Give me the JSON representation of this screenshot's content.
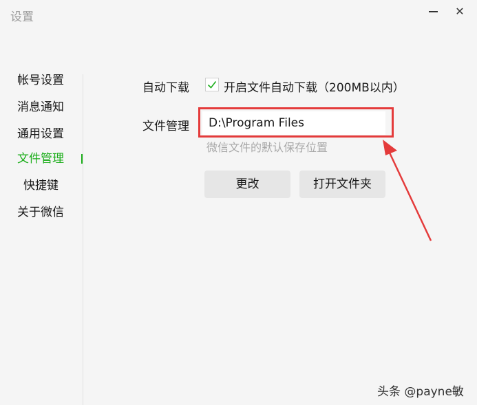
{
  "window": {
    "title": "设置"
  },
  "sidebar": {
    "items": [
      {
        "label": "帐号设置",
        "active": false
      },
      {
        "label": "消息通知",
        "active": false
      },
      {
        "label": "通用设置",
        "active": false
      },
      {
        "label": "文件管理",
        "active": true
      },
      {
        "label": "快捷键",
        "active": false
      },
      {
        "label": "关于微信",
        "active": false
      }
    ]
  },
  "auto_download": {
    "label": "自动下载",
    "checkbox_label": "开启文件自动下载（200MB以内）",
    "checked": true
  },
  "file_management": {
    "label": "文件管理",
    "path": "D:\\Program Files",
    "hint": "微信文件的默认保存位置",
    "change_button": "更改",
    "open_folder_button": "打开文件夹"
  },
  "watermark": "头条 @payne敏",
  "colors": {
    "accent": "#1aad19",
    "highlight": "#e43b3b",
    "background": "#f5f5f5"
  }
}
